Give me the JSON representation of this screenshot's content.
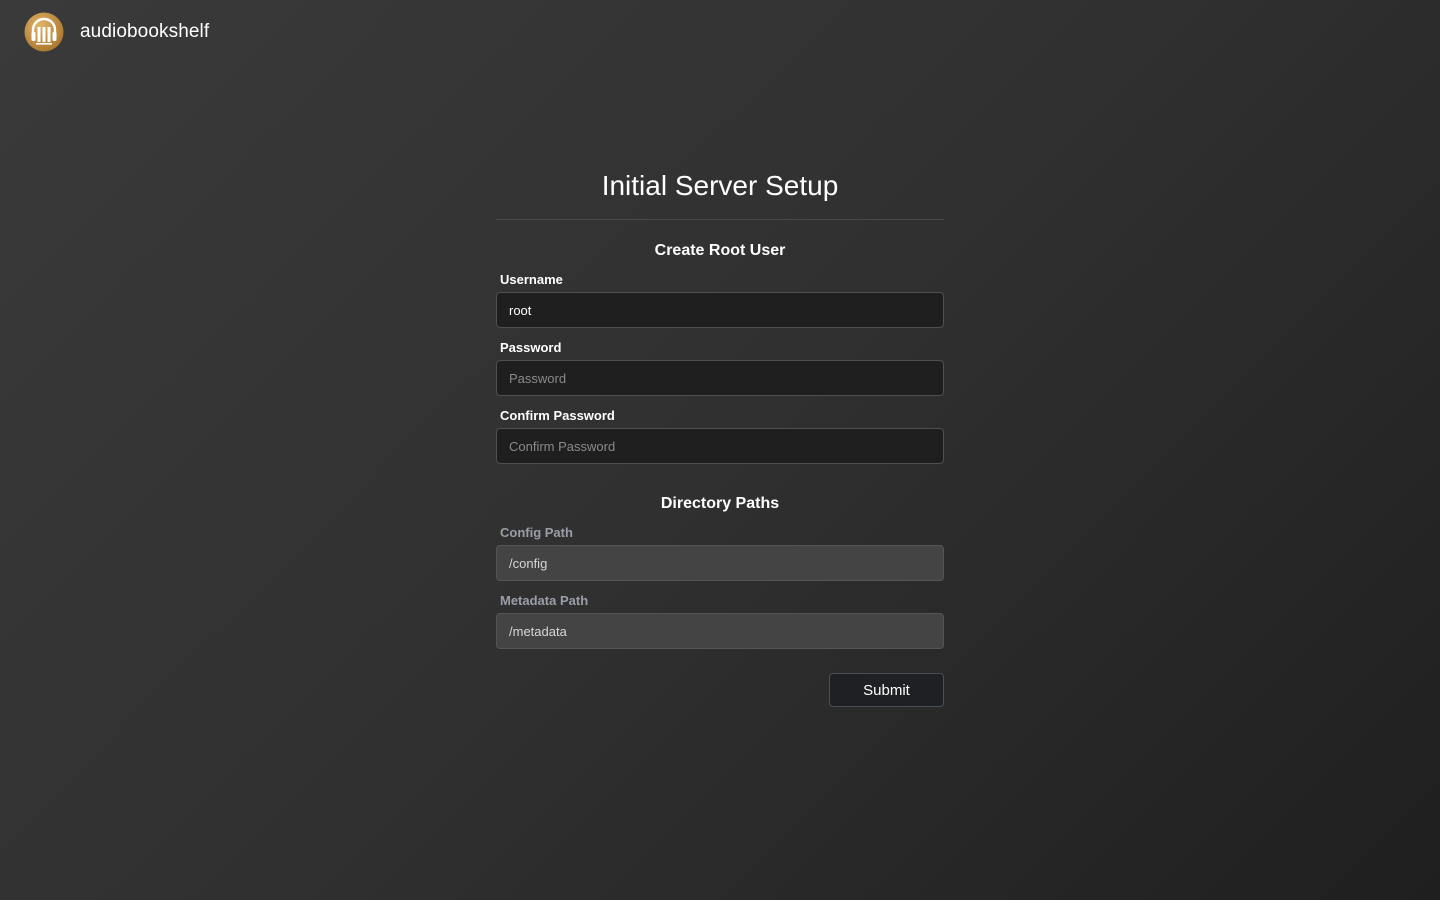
{
  "app": {
    "name": "audiobookshelf",
    "logo_icon": "audiobookshelf-logo-icon",
    "accent_color": "#c08a3a"
  },
  "page": {
    "title": "Initial Server Setup"
  },
  "root_user": {
    "section_title": "Create Root User",
    "username": {
      "label": "Username",
      "value": "root",
      "placeholder": ""
    },
    "password": {
      "label": "Password",
      "value": "",
      "placeholder": "Password"
    },
    "confirm_password": {
      "label": "Confirm Password",
      "value": "",
      "placeholder": "Confirm Password"
    }
  },
  "directory_paths": {
    "section_title": "Directory Paths",
    "config_path": {
      "label": "Config Path",
      "value": "/config"
    },
    "metadata_path": {
      "label": "Metadata Path",
      "value": "/metadata"
    }
  },
  "actions": {
    "submit_label": "Submit"
  }
}
